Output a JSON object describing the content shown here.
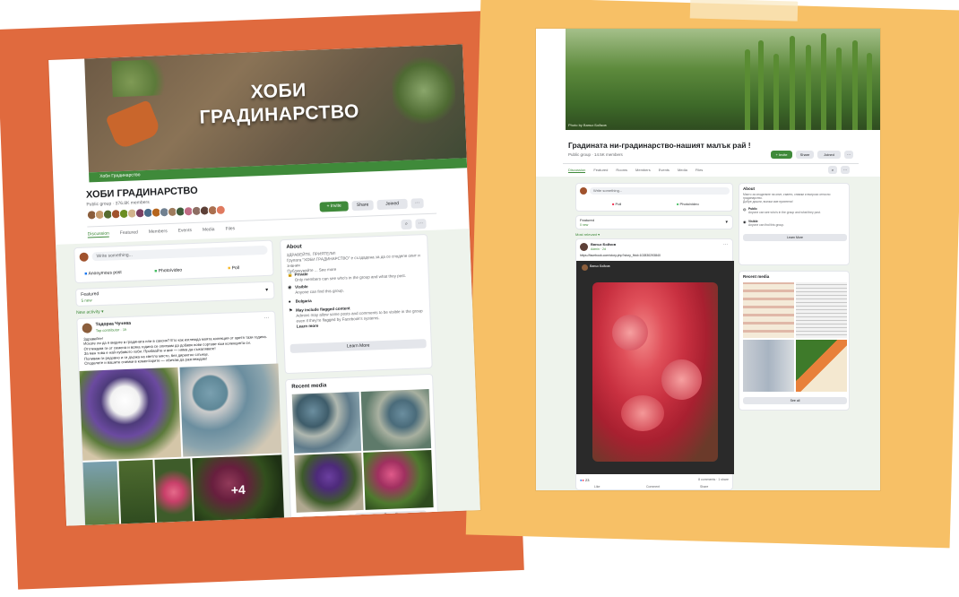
{
  "colors": {
    "accent_green": "#3f8a3a",
    "orange_frame": "#e06a3e",
    "yellow_frame": "#f7c066"
  },
  "left": {
    "cover_title_line1": "ХОБИ",
    "cover_title_line2": "ГРАДИНАРСТВО",
    "cover_strip_label": "Хоби Градинарство",
    "group_name": "ХОБИ ГРАДИНАРСТВО",
    "group_meta": "Public group · 376.8K members",
    "buttons": {
      "invite": "+ Invite",
      "share": "Share",
      "joined": "Joined",
      "more": "···"
    },
    "tabs": [
      "Discussion",
      "Featured",
      "Members",
      "Events",
      "Media",
      "Files"
    ],
    "composer": {
      "placeholder": "Write something...",
      "anon": "Anonymous post",
      "photo": "Photo/video",
      "poll": "Poll"
    },
    "featured": {
      "title": "Featured",
      "count": "5 new",
      "new_activity": "New activity"
    },
    "post": {
      "author": "Тодорка Чучева",
      "meta": "Top contributor · 1h",
      "greeting": "Здравейте!",
      "text1": "Искате ли да я видите в градината или в саксия? Ето как изглежда моята колекция от цветя тази година.",
      "text2": "Отглеждам ги от семена и всяка година се опитвам да добавя нови сортове към колекцията си.",
      "text3": "За мен това е най-хубавото хоби. Пробвайте и вие — няма да съжалявате!",
      "text4": "Поливам ги редовно и ги държа на светло място, без директно слънце.",
      "text5": "Споделете и вашите снимки в коментарите — обичам да разглеждам!",
      "more_count": "+4"
    },
    "about": {
      "title": "About",
      "desc1": "ЗДРАВЕЙТЕ, ПРИЯТЕЛИ!",
      "desc2": "Групата \"ХОБИ ГРАДИНАРСТВО\" е създадена за да се споделя опит и знания",
      "desc3": "Публикувайте ... See more",
      "private_label": "Private",
      "private_desc": "Only members can see who's in the group and what they post.",
      "visible_label": "Visible",
      "visible_desc": "Anyone can find this group.",
      "location": "Bulgaria",
      "flag_label": "May include flagged content",
      "flag_desc": "Admins may allow some posts and comments to be visible in the group even if they're flagged by Facebook's systems.",
      "learn_more": "Learn more",
      "learn_more_btn": "Learn More"
    },
    "recent_media": {
      "title": "Recent media",
      "see_all": "See all"
    }
  },
  "right": {
    "cover_credit": "Photo by Ваньо Бойков",
    "group_title": "Градината ни-градинарство-нашият малък рай !",
    "group_meta": "Public group · 14.5K members",
    "buttons": {
      "invite": "+ Invite",
      "share": "Share",
      "joined": "Joined",
      "more": "···"
    },
    "tabs": [
      "Discussion",
      "Featured",
      "Rooms",
      "Members",
      "Events",
      "Media",
      "Files"
    ],
    "composer": {
      "placeholder": "Write something...",
      "poll": "Poll",
      "photo": "Photo/video"
    },
    "featured": {
      "title": "Featured",
      "count": "0 new",
      "new_activity": "Most relevant"
    },
    "post": {
      "author": "Ваньо Бойков",
      "meta": "Admin · 2d",
      "link": "https://facebook.com/story.php?story_fbid=102830293840",
      "reactions": "23",
      "comments": "8 comments · 1 share",
      "like": "Like",
      "comment": "Comment",
      "share": "Share"
    },
    "about": {
      "title": "About",
      "desc1": "Място за споделяне на опит, съвети, снимки и въпроси относно градинарство.",
      "desc2": "Добре дошли, всички сме приятели!",
      "private_label": "Public",
      "private_desc": "Anyone can see who's in the group and what they post.",
      "visible_label": "Visible",
      "visible_desc": "Anyone can find this group.",
      "learn_more_btn": "Learn More"
    },
    "recent_media": {
      "title": "Recent media",
      "see_all": "See all"
    }
  }
}
